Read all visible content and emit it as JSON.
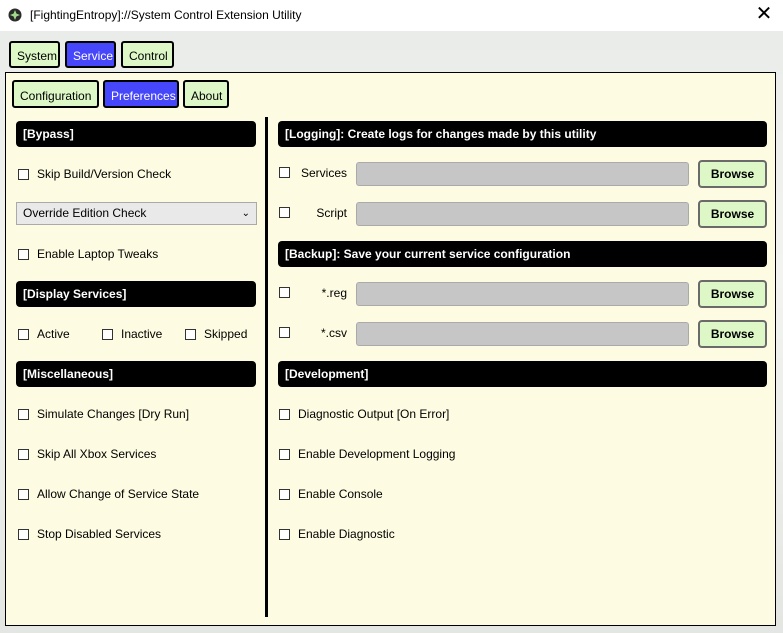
{
  "window": {
    "title": "[FightingEntropy]://System Control Extension Utility"
  },
  "top_tabs": [
    "System",
    "Service",
    "Control"
  ],
  "sub_tabs": [
    "Configuration",
    "Preferences",
    "About"
  ],
  "left": {
    "bypass_header": "[Bypass]",
    "skip_build": "Skip Build/Version Check",
    "override_select": "Override Edition Check",
    "laptop_tweaks": "Enable Laptop Tweaks",
    "display_header": "[Display Services]",
    "display_active": "Active",
    "display_inactive": "Inactive",
    "display_skipped": "Skipped",
    "misc_header": "[Miscellaneous]",
    "misc_simulate": "Simulate Changes [Dry Run]",
    "misc_xbox": "Skip All Xbox Services",
    "misc_allow": "Allow Change of Service State",
    "misc_stop": "Stop Disabled Services"
  },
  "right": {
    "logging_header": "[Logging]: Create logs for changes made by this utility",
    "log_services": "Services",
    "log_script": "Script",
    "backup_header": "[Backup]: Save your current service configuration",
    "backup_reg": "*.reg",
    "backup_csv": "*.csv",
    "browse": "Browse",
    "dev_header": "[Development]",
    "dev_diag_output": "Diagnostic Output [On Error]",
    "dev_logging": "Enable Development Logging",
    "dev_console": "Enable Console",
    "dev_diagnostic": "Enable Diagnostic"
  },
  "colors": {
    "tab_active": "#4646fb",
    "tab_inactive": "#ddf7c7",
    "panel_bg": "#fdfbe1",
    "header_bg": "#000000",
    "path_input": "#c6c6c6"
  }
}
